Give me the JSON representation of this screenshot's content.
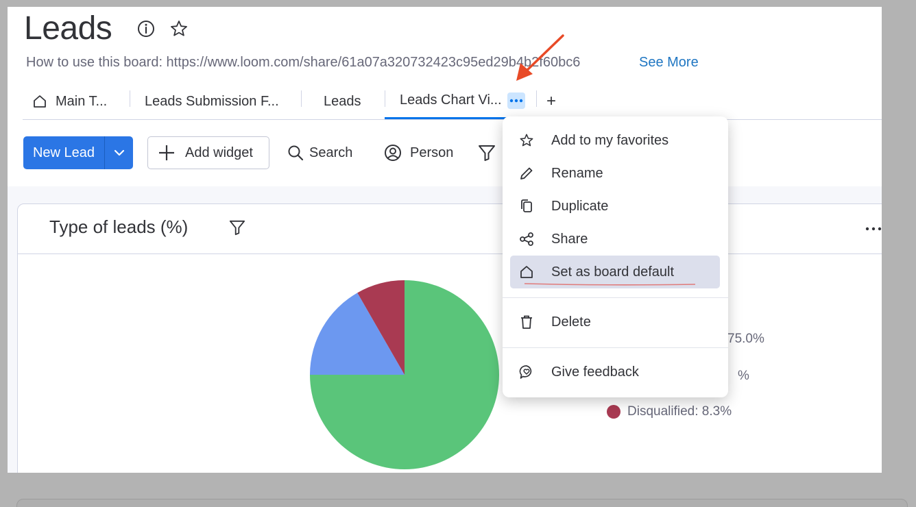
{
  "board": {
    "title": "Leads",
    "description": "How to use this board: https://www.loom.com/share/61a07a320732423c95ed29b4b2f60bc6",
    "see_more": "See More",
    "icons": [
      "info-icon",
      "star-icon"
    ]
  },
  "tabs": [
    {
      "label": "Main T...",
      "icon": "home-icon",
      "active": false
    },
    {
      "label": "Leads Submission F...",
      "active": false
    },
    {
      "label": "Leads",
      "active": false
    },
    {
      "label": "Leads Chart Vi...",
      "active": true
    }
  ],
  "toolbar": {
    "new_lead": "New Lead",
    "add_widget": "Add widget",
    "search": "Search",
    "person": "Person"
  },
  "widget": {
    "title": "Type of leads (%)",
    "chart_data": {
      "type": "pie",
      "slices": [
        {
          "name": "",
          "value": 75.0,
          "color": "#5ac57a"
        },
        {
          "name": "",
          "value": 16.7,
          "color": "#6c98f0"
        },
        {
          "name": "Disqualified",
          "value": 8.3,
          "color": "#a93a52"
        }
      ]
    },
    "legend": [
      {
        "text": "75.0%",
        "color": "#5ac57a"
      },
      {
        "text": "%",
        "color": "#6c98f0"
      },
      {
        "text": "Disqualified: 8.3%",
        "color": "#a93a52"
      }
    ]
  },
  "menu": {
    "items": [
      {
        "label": "Add to my favorites",
        "icon": "star-icon"
      },
      {
        "label": "Rename",
        "icon": "pencil-icon"
      },
      {
        "label": "Duplicate",
        "icon": "copy-icon"
      },
      {
        "label": "Share",
        "icon": "share-icon"
      },
      {
        "label": "Set as board default",
        "icon": "home-icon",
        "highlighted": true
      },
      {
        "label": "Delete",
        "icon": "trash-icon"
      },
      {
        "label": "Give feedback",
        "icon": "feedback-icon"
      }
    ]
  },
  "colors": {
    "primary": "#2b76e5",
    "link": "#1f76c2",
    "annotation_arrow": "#e84a27",
    "menu_highlight": "#dcdfec"
  }
}
